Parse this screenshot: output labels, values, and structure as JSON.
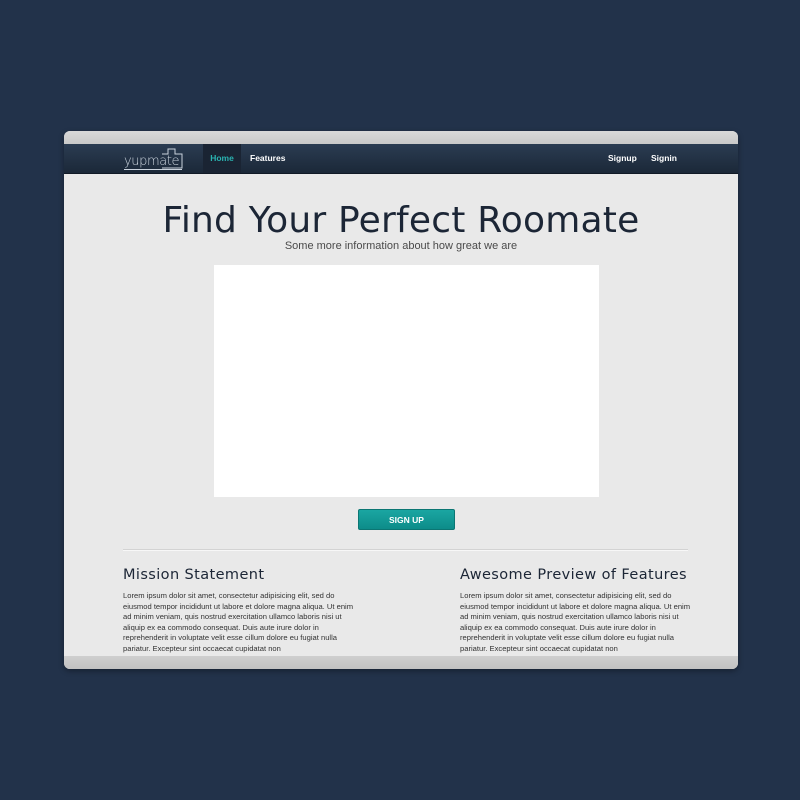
{
  "nav": {
    "logo_text": "yupmate",
    "home_label": "Home",
    "features_label": "Features",
    "signup_label": "Signup",
    "signin_label": "Signin"
  },
  "hero": {
    "title": "Find Your Perfect Roomate",
    "subtitle": "Some more information about how great we are",
    "cta_label": "SIGN UP"
  },
  "columns": [
    {
      "heading": "Mission Statement",
      "body": "Lorem ipsum dolor sit amet, consectetur adipisicing elit, sed do eiusmod tempor incididunt ut labore et dolore magna aliqua. Ut enim ad minim veniam, quis nostrud exercitation ullamco laboris nisi ut aliquip ex ea commodo consequat. Duis aute irure dolor in reprehenderit in voluptate velit esse cillum dolore eu fugiat nulla pariatur. Excepteur sint occaecat cupidatat non"
    },
    {
      "heading": "Awesome Preview of Features",
      "body": "Lorem ipsum dolor sit amet, consectetur adipisicing elit, sed do eiusmod tempor incididunt ut labore et dolore magna aliqua. Ut enim ad minim veniam, quis nostrud exercitation ullamco laboris nisi ut aliquip ex ea commodo consequat. Duis aute irure dolor in reprehenderit in voluptate velit esse cillum dolore eu fugiat nulla pariatur. Excepteur sint occaecat cupidatat non"
    }
  ],
  "colors": {
    "page_background": "#22324a",
    "navbar": "#1f2d3f",
    "accent_teal": "#13a09d",
    "heading_text": "#1c2636"
  }
}
